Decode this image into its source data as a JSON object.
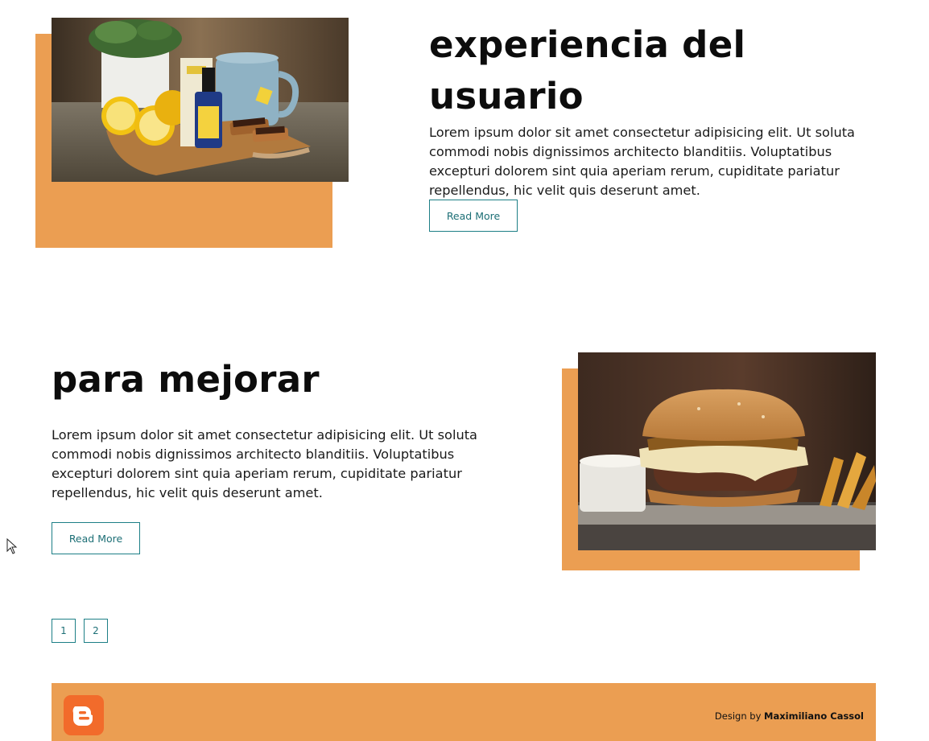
{
  "posts": [
    {
      "title": "experiencia del usuario",
      "excerpt": "Lorem ipsum dolor sit amet consectetur adipisicing elit. Ut soluta commodi nobis dignissimos architecto blanditiis. Voluptatibus excepturi dolorem sint quia aperiam rerum, cupiditate pariatur repellendus, hic velit quis deserunt amet.",
      "read_more": "Read More",
      "image": "cbd-oil-tea-lemons-photo"
    },
    {
      "title": "para mejorar",
      "excerpt": "Lorem ipsum dolor sit amet consectetur adipisicing elit. Ut soluta commodi nobis dignissimos architecto blanditiis. Voluptatibus excepturi dolorem sint quia aperiam rerum, cupiditate pariatur repellendus, hic velit quis deserunt amet.",
      "read_more": "Read More",
      "image": "cheeseburger-fries-photo"
    }
  ],
  "pagination": {
    "pages": [
      "1",
      "2"
    ]
  },
  "footer": {
    "logo_icon": "blogger-icon",
    "credit_prefix": "Design by",
    "credit_name": "Maximiliano Cassol"
  },
  "colors": {
    "accent": "#eb9e52",
    "button_border": "#1d7f86",
    "logo": "#f26b2b"
  }
}
